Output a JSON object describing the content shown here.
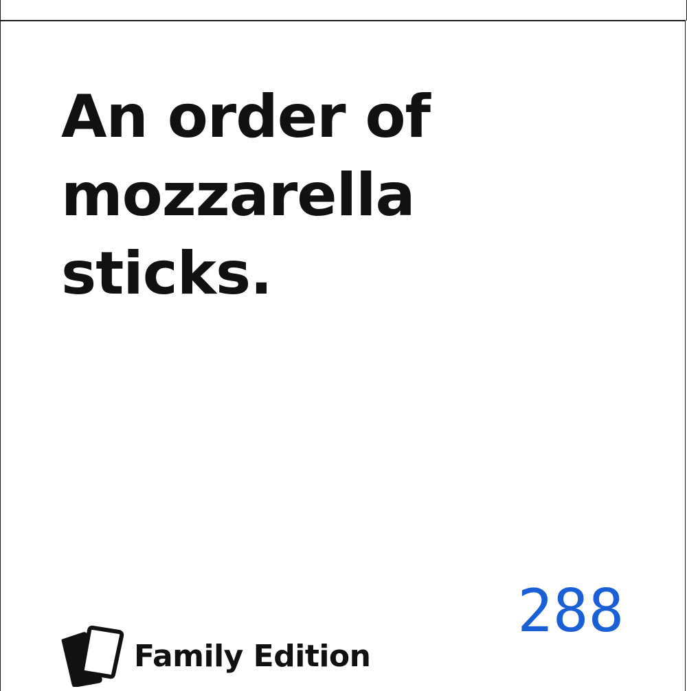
{
  "card": {
    "text": "An order of mozzarella sticks.",
    "number": "288"
  },
  "brand": {
    "name": "Family Edition",
    "logo_icon": "two-cards-icon"
  },
  "colors": {
    "number": "#1b5fd6",
    "text": "#111111",
    "border": "#1a1a1a",
    "background": "#ffffff"
  }
}
